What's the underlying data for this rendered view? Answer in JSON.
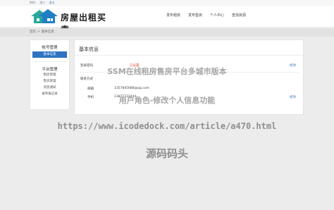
{
  "topbar": {
    "greeting": "你好:",
    "user": "测三",
    "logout": "退出"
  },
  "logo": {
    "text": "房屋出租买卖"
  },
  "nav": {
    "items": [
      "发布租房",
      "发布售房",
      "个人中心",
      "查找房源"
    ]
  },
  "breadcrumb": {
    "home": "首页",
    "separator": ">",
    "current": "基本信息"
  },
  "sidebar": {
    "group1": "帐号管理",
    "group1_items": [
      "基本信息"
    ],
    "group2": "平台管理",
    "group2_items": [
      "租房管理",
      "售房管理",
      "消息通知",
      "被举报记录"
    ]
  },
  "main": {
    "title": "基本信息",
    "login_password_label": "登录密码",
    "login_password_status": "已设置",
    "login_password_edit": "修改",
    "contact_label": "联系方式",
    "email_label": "邮箱",
    "email_value": "1357845688@qq.com",
    "phone_label": "手机",
    "phone_value": "13871232444",
    "phone_edit": "修改"
  },
  "watermark": {
    "line1": "SSM在线租房售房平台多城市版本",
    "line2": "用户角色-修改个人信息功能",
    "url": "https://www.icodedock.com/article/a470.html",
    "brand": "源码码头"
  },
  "colors": {
    "accent": "#2e74c2",
    "warning": "#e04a3f",
    "link": "#3a78c3"
  }
}
